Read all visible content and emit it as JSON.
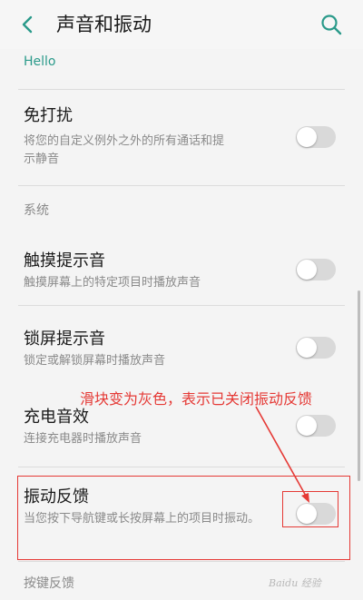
{
  "header": {
    "title": "声音和振动",
    "back_icon": "chevron-left-icon",
    "search_icon": "search-icon"
  },
  "breadcrumb": "Hello",
  "items": {
    "dnd": {
      "title": "免打扰",
      "desc": "将您的自定义例外之外的所有通话和提示静音",
      "enabled": false
    },
    "touch": {
      "title": "触摸提示音",
      "desc": "触摸屏幕上的特定项目时播放声音",
      "enabled": false
    },
    "lock": {
      "title": "锁屏提示音",
      "desc": "锁定或解锁屏幕时播放声音",
      "enabled": false
    },
    "charge": {
      "title": "充电音效",
      "desc": "连接充电器时播放声音",
      "enabled": false
    },
    "vibrate": {
      "title": "振动反馈",
      "desc": "当您按下导航键或长按屏幕上的项目时振动。",
      "enabled": false
    }
  },
  "sections": {
    "system": "系统",
    "key_feedback": "按键反馈"
  },
  "annotation": {
    "text": "滑块变为灰色，表示已关闭振动反馈",
    "color": "#e53935"
  },
  "watermark": "Baidu 经验",
  "colors": {
    "accent": "#2a9a8a",
    "switch_off": "#d9d9d9",
    "annotation_red": "#e53935"
  }
}
